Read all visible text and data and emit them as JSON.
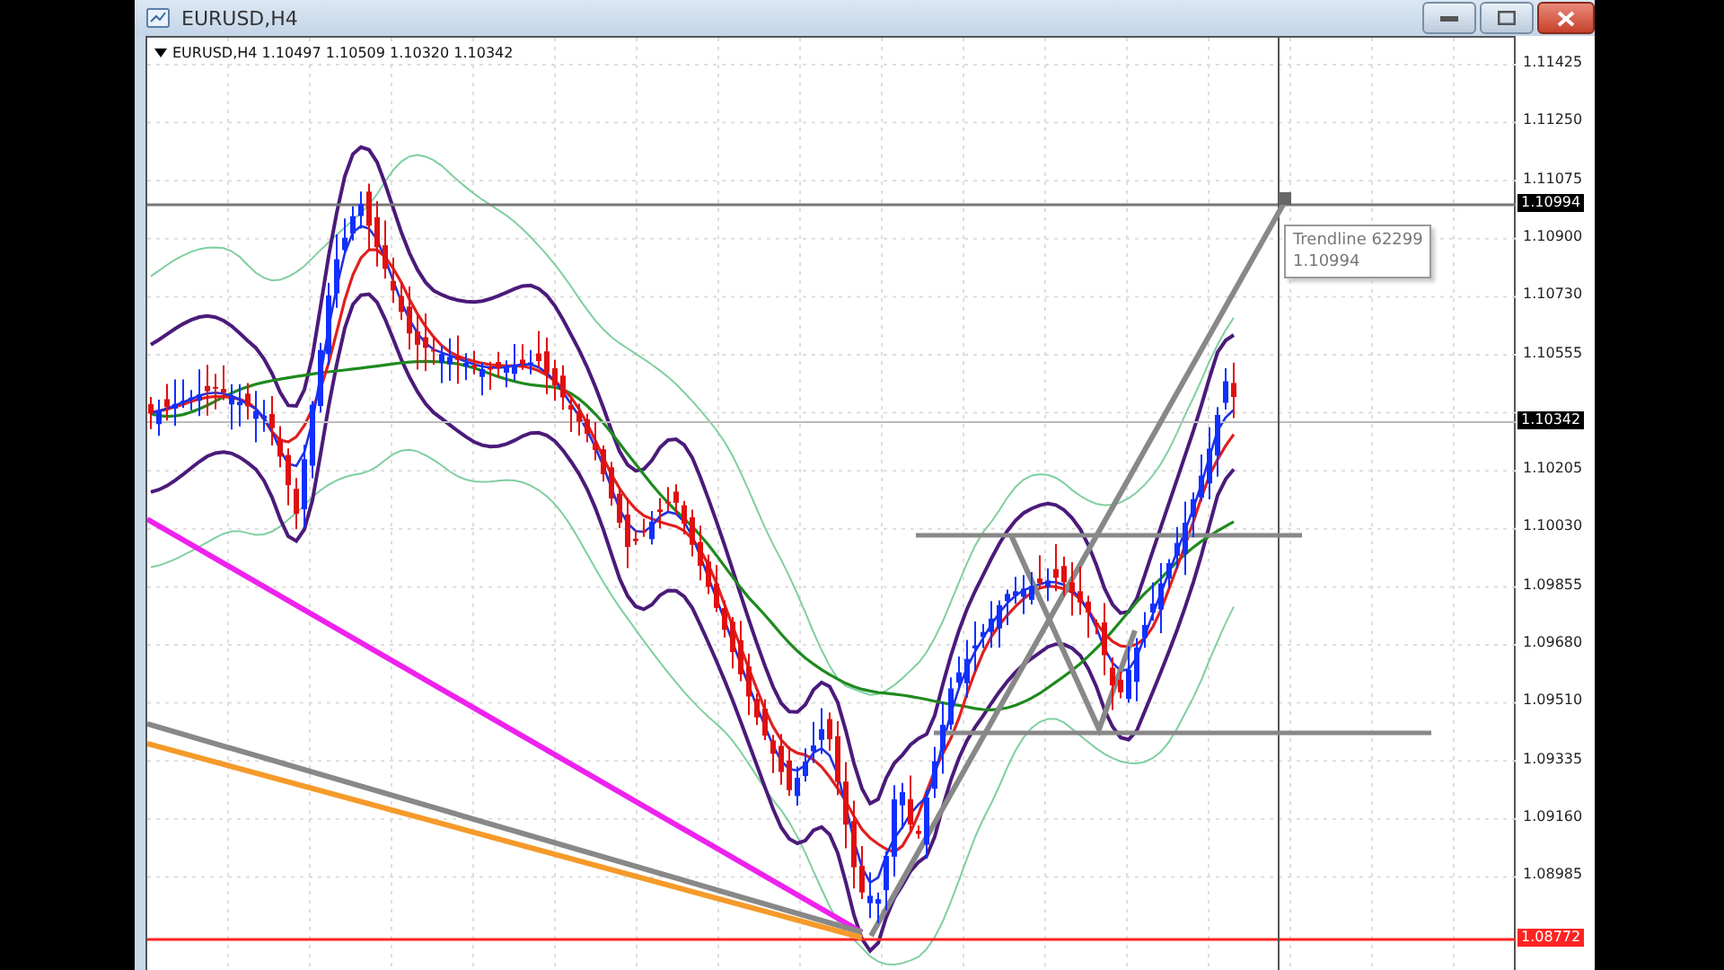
{
  "window": {
    "title": "EURUSD,H4"
  },
  "chart": {
    "header": "EURUSD,H4  1.10497 1.10509 1.10320 1.10342",
    "tooltip": {
      "title": "Trendline 62299",
      "value": "1.10994"
    }
  },
  "price_axis": {
    "ticks": [
      "1.11425",
      "1.11250",
      "1.11075",
      "1.10900",
      "1.10730",
      "1.10555",
      "1.10205",
      "1.10030",
      "1.09855",
      "1.09680",
      "1.09510",
      "1.09335",
      "1.09160",
      "1.08985"
    ],
    "price_tags": [
      {
        "label": "1.10994",
        "kind": "line"
      },
      {
        "label": "1.10342",
        "kind": "bid"
      },
      {
        "label": "1.08772",
        "kind": "alert"
      }
    ]
  }
}
